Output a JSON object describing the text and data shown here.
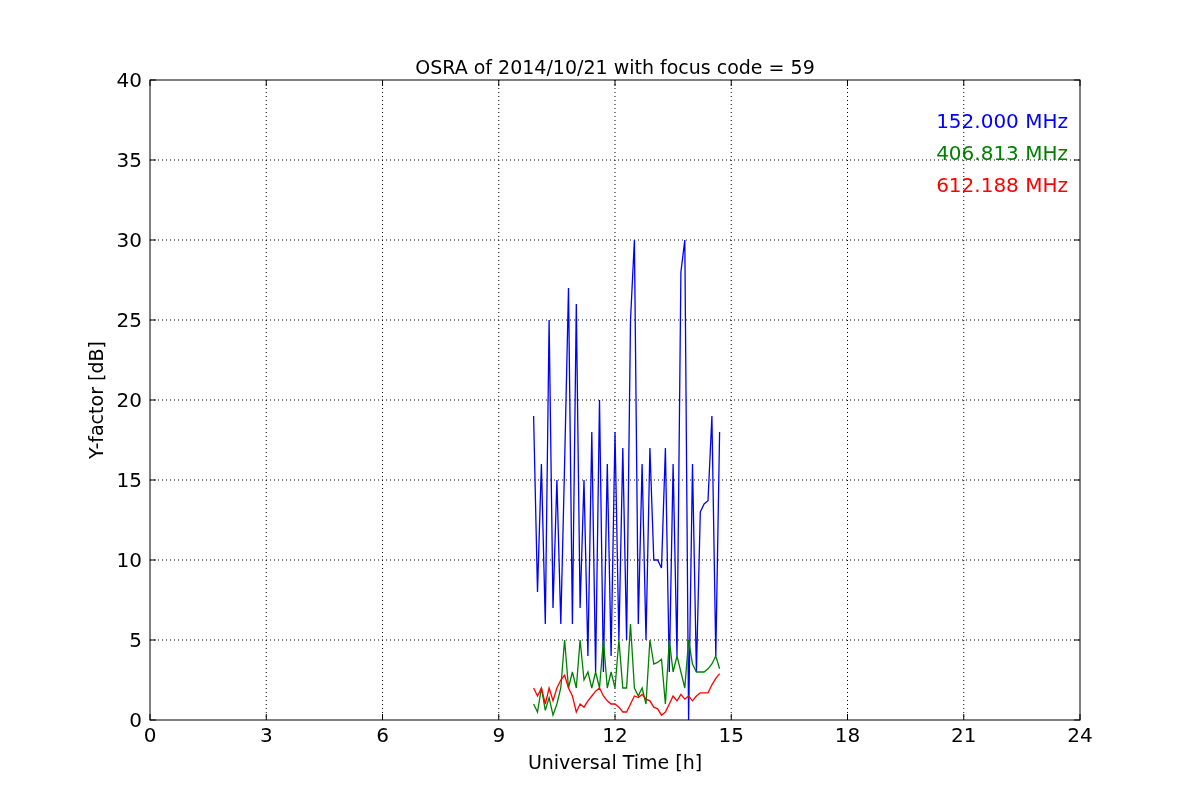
{
  "chart_data": {
    "type": "line",
    "title": "OSRA of 2014/10/21 with focus code = 59",
    "xlabel": "Universal Time [h]",
    "ylabel": "Y-factor [dB]",
    "x": [
      9.9,
      10.0,
      10.1,
      10.2,
      10.3,
      10.4,
      10.5,
      10.6,
      10.7,
      10.8,
      10.9,
      11.0,
      11.1,
      11.2,
      11.3,
      11.4,
      11.5,
      11.6,
      11.7,
      11.8,
      11.9,
      12.0,
      12.1,
      12.2,
      12.3,
      12.4,
      12.5,
      12.6,
      12.7,
      12.8,
      12.9,
      13.0,
      13.1,
      13.2,
      13.3,
      13.4,
      13.5,
      13.6,
      13.7,
      13.8,
      13.9,
      14.0,
      14.1,
      14.2,
      14.3,
      14.4,
      14.5,
      14.6,
      14.7
    ],
    "series": [
      {
        "name": "152.000 MHz",
        "color": "#0000ff",
        "values": [
          19,
          8,
          16,
          6,
          25,
          7,
          15,
          6,
          16,
          27,
          6,
          26,
          7,
          15,
          4,
          18,
          3,
          20,
          3,
          16,
          4,
          18,
          5,
          17,
          5,
          25,
          30,
          6,
          16,
          5,
          17,
          10,
          10,
          9.5,
          17,
          3,
          16,
          4,
          28,
          30,
          0,
          16,
          3,
          13,
          13.5,
          13.7,
          19,
          4,
          18
        ]
      },
      {
        "name": "406.813 MHz",
        "color": "#008000",
        "values": [
          1,
          0.5,
          2,
          0.6,
          1.4,
          0.3,
          1,
          2,
          5,
          2,
          3,
          2,
          5,
          2.5,
          3,
          2,
          3,
          2,
          5,
          2,
          3,
          2,
          5,
          2,
          2,
          6,
          2,
          1.5,
          2,
          1,
          5,
          3.5,
          3.6,
          3.8,
          1,
          5,
          3,
          4,
          3,
          2,
          5,
          3.5,
          3,
          3,
          3,
          3.2,
          3.5,
          4,
          3.2
        ]
      },
      {
        "name": "612.188 MHz",
        "color": "#ff0000",
        "values": [
          2,
          1.5,
          2,
          1,
          2,
          1.2,
          2,
          2.5,
          2.8,
          2,
          1.5,
          0.5,
          1,
          0.8,
          1.2,
          1.5,
          1.8,
          2,
          1.5,
          1.2,
          1,
          1,
          0.8,
          0.5,
          0.5,
          1,
          1.5,
          1.4,
          1.6,
          1.3,
          1.2,
          0.8,
          0.7,
          0.3,
          0.5,
          1,
          1.5,
          1.2,
          1.6,
          1.3,
          1.5,
          1.2,
          1.5,
          1.7,
          1.7,
          1.7,
          2.2,
          2.6,
          2.9
        ]
      }
    ],
    "grid": true,
    "xlim": [
      0,
      24
    ],
    "ylim": [
      0,
      40
    ],
    "xticks": [
      0,
      3,
      6,
      9,
      12,
      15,
      18,
      21,
      24
    ],
    "yticks": [
      0,
      5,
      10,
      15,
      20,
      25,
      30,
      35,
      40
    ]
  }
}
